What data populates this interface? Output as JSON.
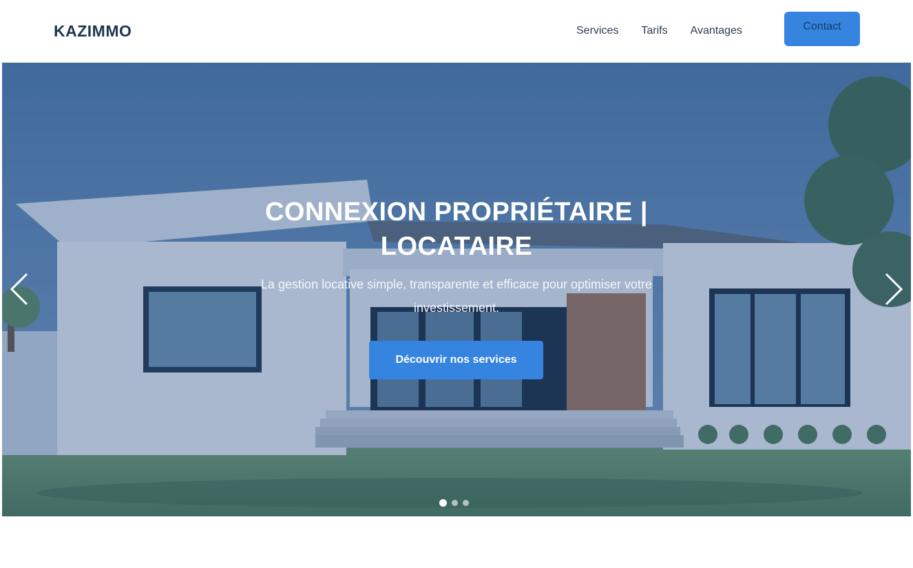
{
  "header": {
    "logo": "KAZIMMO",
    "nav": [
      "Services",
      "Tarifs",
      "Avantages"
    ],
    "contact_label": "Contact"
  },
  "hero": {
    "title_line1": "CONNEXION PROPRIÉTAIRE |",
    "title_line2": "LOCATAIRE",
    "subtitle_line1": "La gestion locative simple, transparente et efficace pour optimiser votre",
    "subtitle_line2": "investissement.",
    "cta_label": "Découvrir nos services",
    "slide_count": 3,
    "active_slide": 1
  },
  "icons": {
    "prev": "chevron-left-icon",
    "next": "chevron-right-icon"
  },
  "colors": {
    "brand": "#1f3552",
    "accent": "#3584df",
    "overlay": "#284e87"
  }
}
